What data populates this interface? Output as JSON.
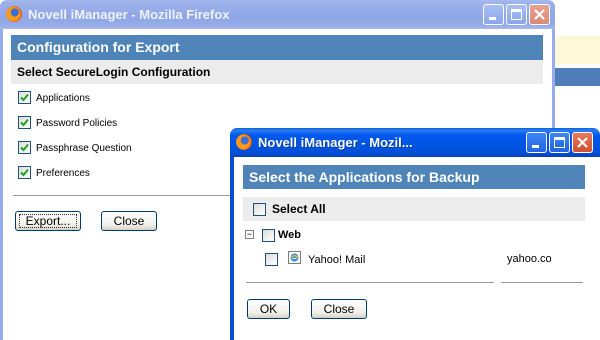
{
  "background": {
    "strip_colors": [
      "#ffffff",
      "#fdf8d8",
      "#ffffff",
      "#4f7db8",
      "#ffffff"
    ]
  },
  "export_window": {
    "title": "Novell iManager - Mozilla Firefox",
    "header": "Configuration for Export",
    "subheader": "Select SecureLogin Configuration",
    "options": [
      {
        "label": "Applications",
        "checked": true
      },
      {
        "label": "Password Policies",
        "checked": true
      },
      {
        "label": "Passphrase Question",
        "checked": true
      },
      {
        "label": "Preferences",
        "checked": true
      }
    ],
    "export_label": "Export...",
    "close_label": "Close"
  },
  "backup_window": {
    "title": "Novell iManager - Mozil...",
    "header": "Select the Applications for Backup",
    "select_all_label": "Select All",
    "tree": {
      "expander": "−",
      "group_label": "Web",
      "items": [
        {
          "label": "Yahoo! Mail",
          "value": "yahoo.co",
          "icon": "ie-globe-icon"
        }
      ]
    },
    "ok_label": "OK",
    "close_label": "Close"
  },
  "colors": {
    "header_blue": "#4f84b8",
    "xp_title_active": "#0054e3",
    "xp_title_inactive": "#97acea",
    "check_green": "#21a121"
  }
}
